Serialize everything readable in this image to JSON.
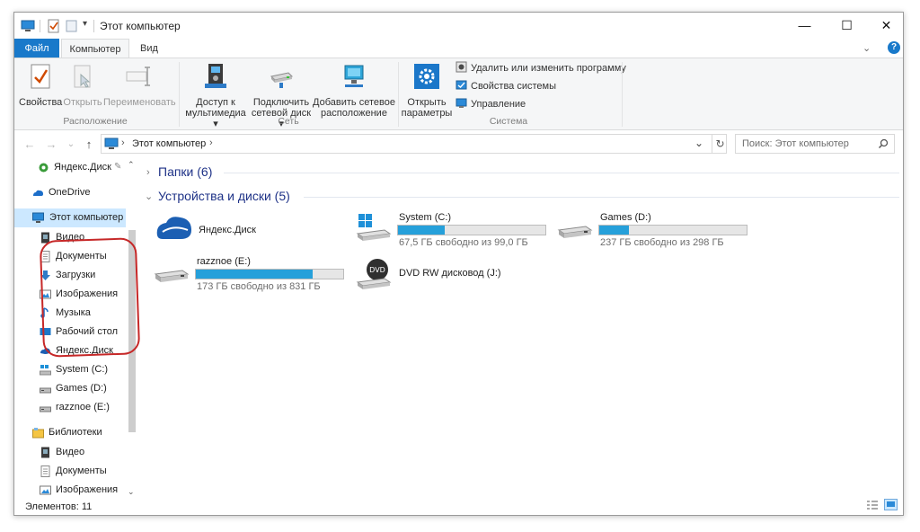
{
  "titlebar": {
    "title": "Этот компьютер",
    "minimize": "—",
    "maximize": "☐",
    "close": "✕"
  },
  "tabs": [
    {
      "label": "Файл"
    },
    {
      "label": "Компьютер"
    },
    {
      "label": "Вид"
    }
  ],
  "help": "?",
  "ribbon": {
    "location_group": {
      "label": "Расположение",
      "items": [
        {
          "label": "Свойства",
          "icon": "properties-icon",
          "enabled": true
        },
        {
          "label": "Открыть",
          "icon": "open-icon",
          "enabled": false
        },
        {
          "label": "Переименовать",
          "icon": "rename-icon",
          "enabled": false
        }
      ]
    },
    "network_group": {
      "label": "Сеть",
      "items": [
        {
          "line1": "Доступ к",
          "line2": "мультимедиа ▾",
          "icon": "media-access-icon"
        },
        {
          "line1": "Подключить",
          "line2": "сетевой диск ▾",
          "icon": "map-drive-icon"
        },
        {
          "line1": "Добавить сетевое",
          "line2": "расположение",
          "icon": "add-network-location-icon"
        }
      ]
    },
    "system_group": {
      "label": "Система",
      "big": {
        "line1": "Открыть",
        "line2": "параметры",
        "icon": "settings-icon"
      },
      "small": [
        {
          "label": "Удалить или изменить программу",
          "icon": "uninstall-icon"
        },
        {
          "label": "Свойства системы",
          "icon": "system-properties-icon"
        },
        {
          "label": "Управление",
          "icon": "management-icon"
        }
      ]
    }
  },
  "addressbar": {
    "path": "Этот компьютер",
    "separator": "›",
    "search_placeholder": "Поиск: Этот компьютер"
  },
  "navpane": {
    "items": [
      {
        "label": "Яндекс.Диск"
      },
      {
        "label": "OneDrive"
      },
      {
        "label": "Этот компьютер"
      },
      {
        "label": "Видео"
      },
      {
        "label": "Документы"
      },
      {
        "label": "Загрузки"
      },
      {
        "label": "Изображения"
      },
      {
        "label": "Музыка"
      },
      {
        "label": "Рабочий стол"
      },
      {
        "label": "Яндекс.Диск"
      },
      {
        "label": "System (C:)"
      },
      {
        "label": "Games (D:)"
      },
      {
        "label": "razznoe (E:)"
      },
      {
        "label": "Библиотеки"
      },
      {
        "label": "Видео"
      },
      {
        "label": "Документы"
      },
      {
        "label": "Изображения"
      }
    ]
  },
  "content": {
    "folders_header": "Папки (6)",
    "devices_header": "Устройства и диски (5)",
    "drives": [
      {
        "name": "Яндекс.Диск",
        "free": "",
        "used_fraction": null
      },
      {
        "name": "System (C:)",
        "free": "67,5 ГБ свободно из 99,0 ГБ",
        "used_fraction": 0.32
      },
      {
        "name": "Games (D:)",
        "free": "237 ГБ свободно из 298 ГБ",
        "used_fraction": 0.2
      },
      {
        "name": "razznoe (E:)",
        "free": "173 ГБ свободно из 831 ГБ",
        "used_fraction": 0.79
      },
      {
        "name": "DVD RW дисковод (J:)",
        "free": "",
        "used_fraction": null
      }
    ]
  },
  "status": {
    "items_count": "Элементов: 11"
  },
  "colors": {
    "accent": "#1979ca",
    "bar_fill": "#26a0da",
    "annotation": "#c62828",
    "group_header": "#1e3287"
  }
}
